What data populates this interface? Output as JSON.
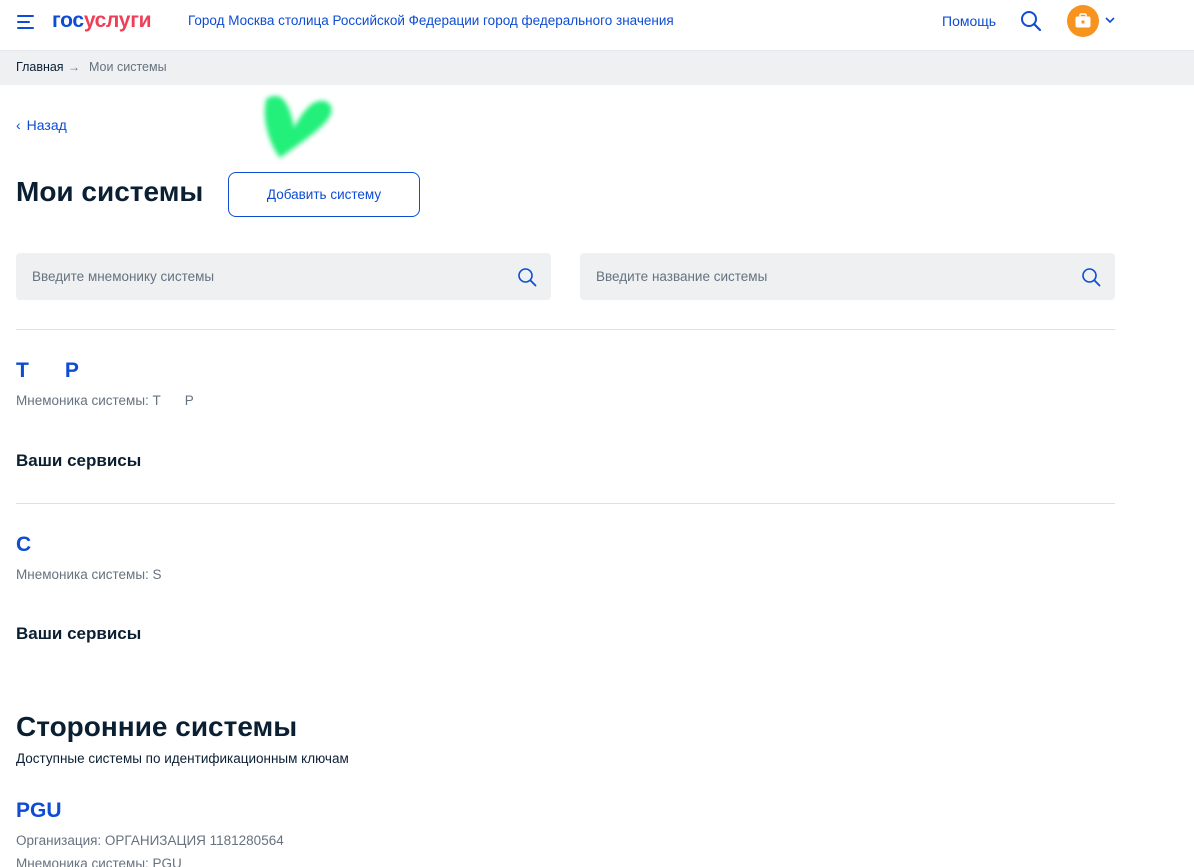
{
  "header": {
    "logo_part1": "гос",
    "logo_part2": "услуги",
    "location": "Город Москва столица Российской Федерации город федерального значения",
    "help_label": "Помощь",
    "menu_icon": "hamburger-icon",
    "search_icon": "search-icon",
    "avatar_icon": "briefcase-icon",
    "accent_color": "#0d4cd3",
    "logo_red": "#ee3f58",
    "avatar_color": "#f7931e"
  },
  "breadcrumb": {
    "home": "Главная",
    "separator": "→",
    "current": "Мои системы"
  },
  "back_label": "Назад",
  "page": {
    "title": "Мои системы",
    "add_button": "Добавить систему",
    "search_mnemonic_placeholder": "Введите мнемонику системы",
    "search_name_placeholder": "Введите название системы"
  },
  "my_systems": [
    {
      "name": "T… P",
      "name_visible_start": "T",
      "name_visible_end": "P",
      "mnemonic_label": "Мнемоника системы: T",
      "mnemonic_end": "P",
      "services_title": "Ваши сервисы"
    },
    {
      "name_visible_start": "C",
      "mnemonic_label": "Мнемоника системы: S",
      "services_title": "Ваши сервисы"
    }
  ],
  "third_party": {
    "title": "Сторонние системы",
    "subtitle": "Доступные системы по идентификационным ключам",
    "systems": [
      {
        "name": "PGU",
        "organization": "Организация: ОРГАНИЗАЦИЯ 1181280564",
        "mnemonic": "Мнемоника системы: PGU"
      }
    ]
  }
}
